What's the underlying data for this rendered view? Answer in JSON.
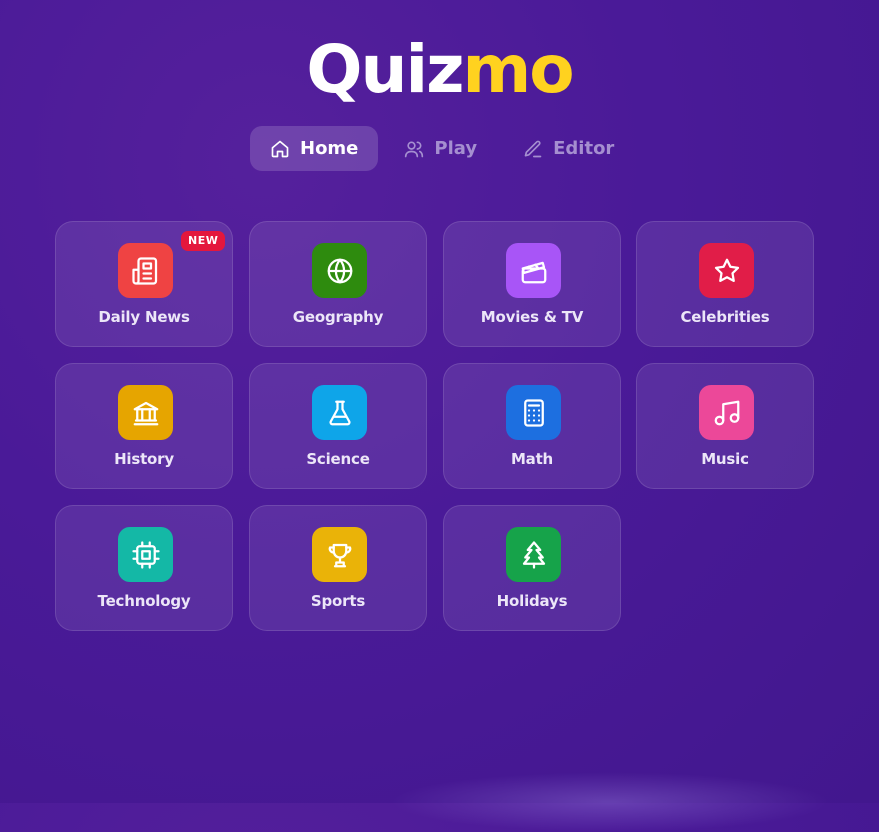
{
  "logo": {
    "part1": "Quiz",
    "part2": "mo"
  },
  "nav": {
    "home": "Home",
    "play": "Play",
    "editor": "Editor"
  },
  "badge": "NEW",
  "categories": [
    {
      "label": "Daily News",
      "icon": "newspaper-icon",
      "color": "#ef4343"
    },
    {
      "label": "Geography",
      "icon": "globe-icon",
      "color": "#2e8b0e"
    },
    {
      "label": "Movies & TV",
      "icon": "clapperboard-icon",
      "color": "#a855f7"
    },
    {
      "label": "Celebrities",
      "icon": "star-icon",
      "color": "#e11d48"
    },
    {
      "label": "History",
      "icon": "landmark-icon",
      "color": "#e6a500"
    },
    {
      "label": "Science",
      "icon": "flask-icon",
      "color": "#0ea5e9"
    },
    {
      "label": "Math",
      "icon": "calculator-icon",
      "color": "#1d6fe0"
    },
    {
      "label": "Music",
      "icon": "music-icon",
      "color": "#ec4899"
    },
    {
      "label": "Technology",
      "icon": "cpu-icon",
      "color": "#14b8a6"
    },
    {
      "label": "Sports",
      "icon": "trophy-icon",
      "color": "#eab308"
    },
    {
      "label": "Holidays",
      "icon": "tree-icon",
      "color": "#16a34a"
    }
  ]
}
